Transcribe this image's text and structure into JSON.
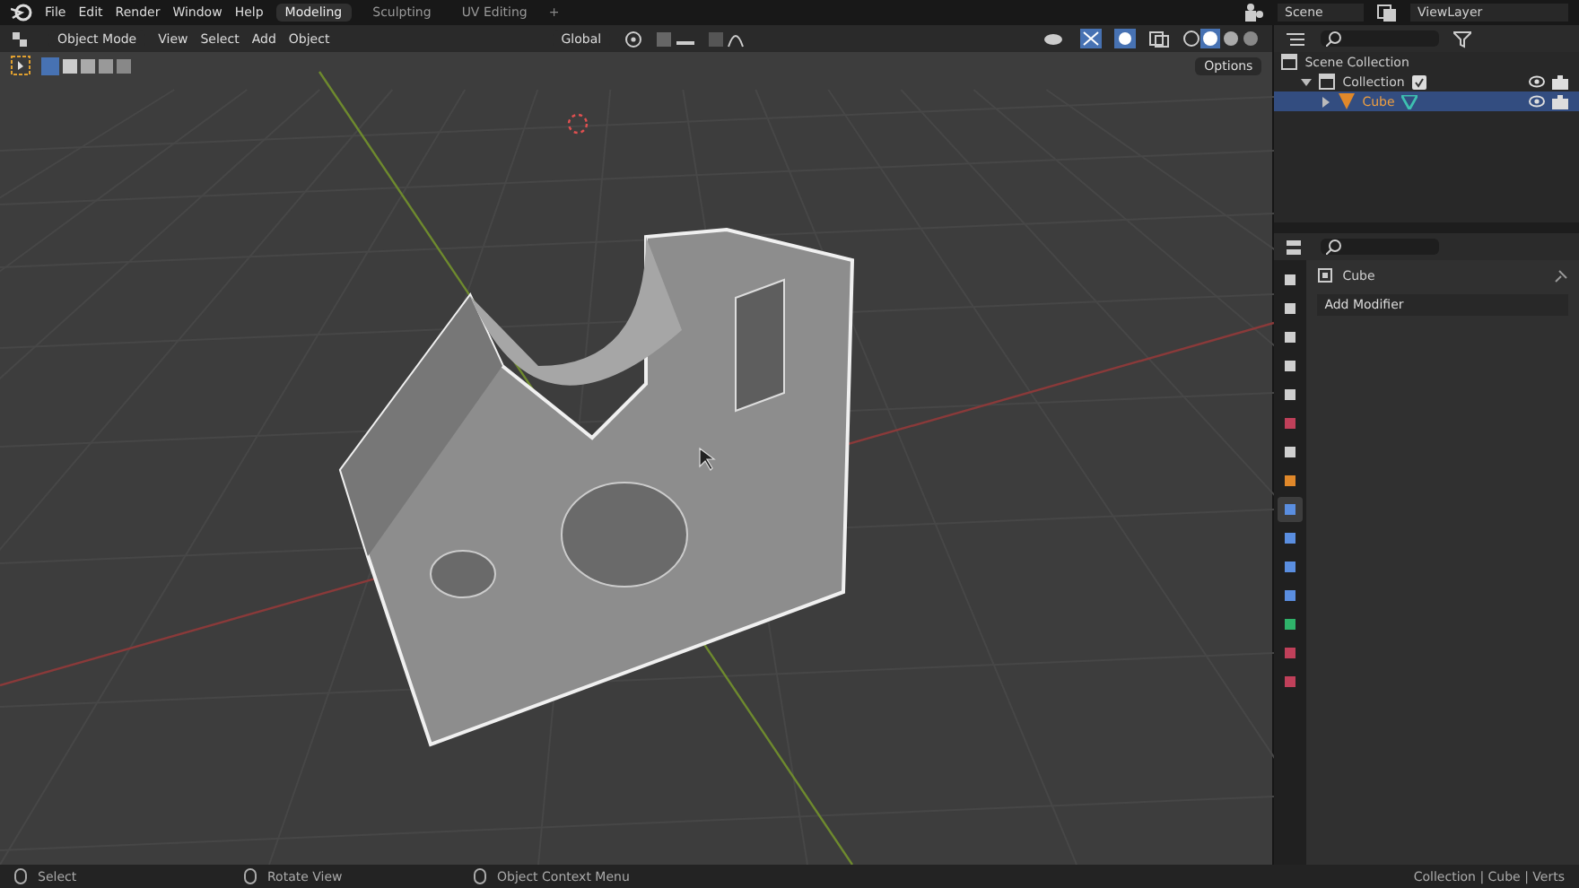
{
  "menu_bar": {
    "menus": [
      "File",
      "Edit",
      "Render",
      "Window",
      "Help"
    ],
    "workspaces": [
      {
        "label": "Modeling",
        "selected": true
      },
      {
        "label": "Sculpting",
        "selected": false
      },
      {
        "label": "UV Editing",
        "selected": false
      }
    ],
    "add_tab": "+",
    "scene": "Scene",
    "view_layer": "ViewLayer"
  },
  "viewport_header": {
    "mode": "Object Mode",
    "menus": [
      "View",
      "Select",
      "Add",
      "Object"
    ],
    "orientation": "Global",
    "options": "Options"
  },
  "outliner": {
    "items": [
      {
        "label": "Scene Collection",
        "kind": "scene",
        "selected": false,
        "children": [
          {
            "label": "Collection",
            "kind": "collection",
            "selected": false,
            "expanded": true,
            "children": [
              {
                "label": "Cube",
                "kind": "object",
                "selected": true,
                "expanded": false
              }
            ]
          }
        ]
      }
    ]
  },
  "properties": {
    "object_name": "Cube",
    "add_modifier": "Add Modifier",
    "tabs": [
      {
        "kind": "tool",
        "selected": false
      },
      {
        "kind": "render",
        "selected": false
      },
      {
        "kind": "output",
        "selected": false
      },
      {
        "kind": "view_layer",
        "selected": false
      },
      {
        "kind": "scene",
        "selected": false
      },
      {
        "kind": "world",
        "selected": false
      },
      {
        "kind": "collection",
        "selected": false
      },
      {
        "kind": "object",
        "selected": false
      },
      {
        "kind": "modifier",
        "selected": true
      },
      {
        "kind": "particles",
        "selected": false
      },
      {
        "kind": "physics",
        "selected": false
      },
      {
        "kind": "constraints",
        "selected": false
      },
      {
        "kind": "data",
        "selected": false
      },
      {
        "kind": "material",
        "selected": false
      },
      {
        "kind": "texture",
        "selected": false
      }
    ]
  },
  "status_bar": {
    "items": [
      "Select",
      "Rotate View",
      "Object Context Menu"
    ],
    "stats": "Collection | Cube | Verts"
  }
}
